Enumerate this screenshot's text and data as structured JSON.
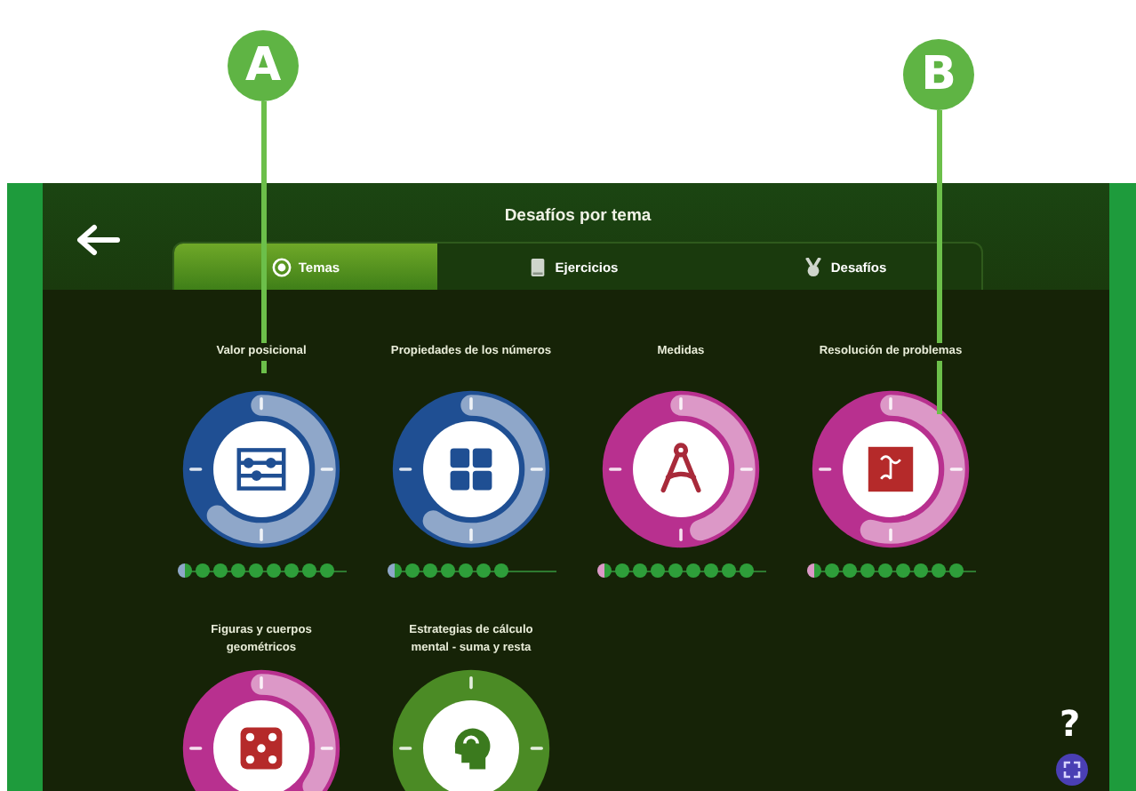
{
  "callouts": [
    {
      "letter": "A"
    },
    {
      "letter": "B"
    }
  ],
  "title": "Desafíos por tema",
  "tabs": [
    {
      "label": "Temas",
      "selected": true
    },
    {
      "label": "Ejercicios",
      "selected": false
    },
    {
      "label": "Desafíos",
      "selected": false
    }
  ],
  "topics": [
    {
      "label": "Valor posicional",
      "kind": "abacus",
      "color": "#1f4f93",
      "level": 0.62,
      "steps": [
        {
          "kind": "current"
        },
        {
          "kind": "done"
        },
        {
          "kind": "done"
        },
        {
          "kind": "done"
        },
        {
          "kind": "done"
        },
        {
          "kind": "done"
        },
        {
          "kind": "done"
        },
        {
          "kind": "done"
        },
        {
          "kind": "done"
        }
      ]
    },
    {
      "label": "Propiedades de los números",
      "kind": "calculator",
      "color": "#1f4f93",
      "level": 0.6,
      "steps": [
        {
          "kind": "current"
        },
        {
          "kind": "done"
        },
        {
          "kind": "done"
        },
        {
          "kind": "done"
        },
        {
          "kind": "done"
        },
        {
          "kind": "done"
        },
        {
          "kind": "done"
        }
      ]
    },
    {
      "label": "Medidas",
      "kind": "compass",
      "color": "#b8308f",
      "level": 0.45,
      "steps": [
        {
          "kind": "current"
        },
        {
          "kind": "done"
        },
        {
          "kind": "done"
        },
        {
          "kind": "done"
        },
        {
          "kind": "done"
        },
        {
          "kind": "done"
        },
        {
          "kind": "done"
        },
        {
          "kind": "done"
        },
        {
          "kind": "done"
        }
      ]
    },
    {
      "label": "Resolución de problemas",
      "kind": "puzzle",
      "color": "#b8308f",
      "level": 0.55,
      "steps": [
        {
          "kind": "current"
        },
        {
          "kind": "done"
        },
        {
          "kind": "done"
        },
        {
          "kind": "done"
        },
        {
          "kind": "done"
        },
        {
          "kind": "done"
        },
        {
          "kind": "done"
        },
        {
          "kind": "done"
        },
        {
          "kind": "done"
        }
      ]
    },
    {
      "label": "Figuras y cuerpos\ngeométricos",
      "kind": "die",
      "color": "#b8308f",
      "level": 0.35
    },
    {
      "label": "Estrategias de cálculo\nmental - suma y resta",
      "kind": "head",
      "color": "#4b8b25"
    }
  ],
  "help": "?"
}
